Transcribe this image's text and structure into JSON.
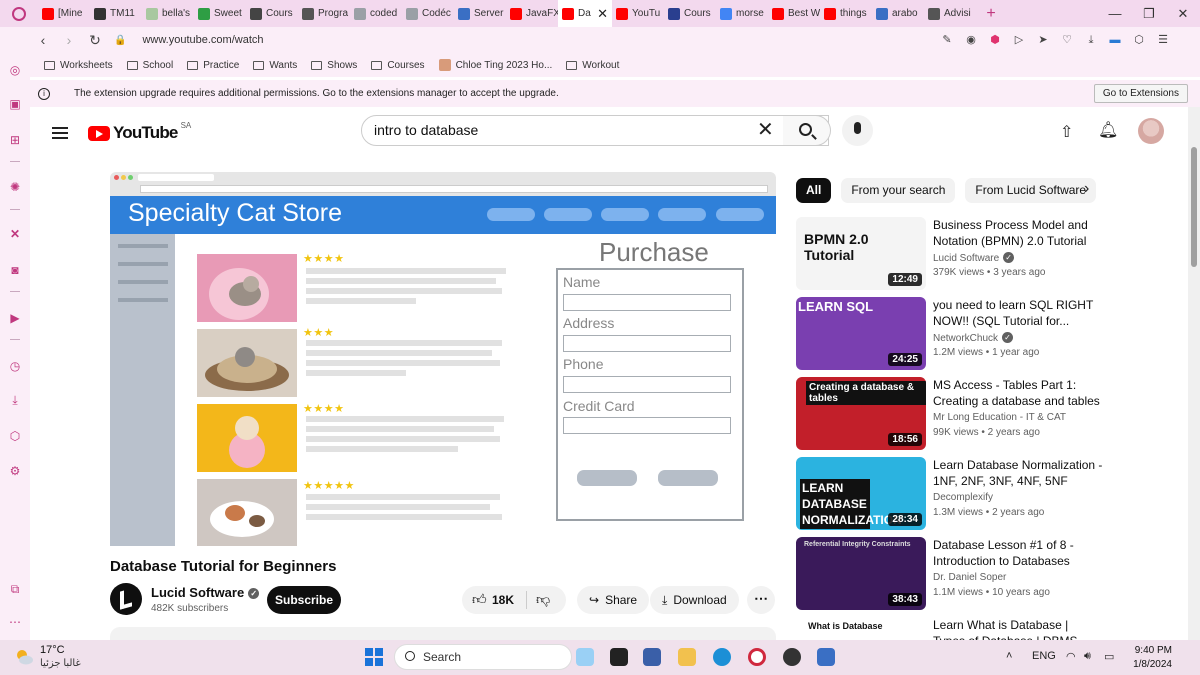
{
  "browser": {
    "tabs": [
      {
        "label": "[Mine",
        "color": "#ff0000"
      },
      {
        "label": "TM11",
        "color": "#333333"
      },
      {
        "label": "bella's",
        "color": "#a8c8a0"
      },
      {
        "label": "Sweet",
        "color": "#2e9e44"
      },
      {
        "label": "Cours",
        "color": "#444444"
      },
      {
        "label": "Progra",
        "color": "#555555"
      },
      {
        "label": "coded",
        "color": "#9aa0a6"
      },
      {
        "label": "Codéc",
        "color": "#9aa0a6"
      },
      {
        "label": "Server",
        "color": "#3a6fc4"
      },
      {
        "label": "JavaFX",
        "color": "#ff0000"
      },
      {
        "label": "Da",
        "color": "#ff0000",
        "active": true
      },
      {
        "label": "YouTu",
        "color": "#ff0000"
      },
      {
        "label": "Cours",
        "color": "#2a3f8f"
      },
      {
        "label": "morse",
        "color": "#4285f4"
      },
      {
        "label": "Best W",
        "color": "#ff0000"
      },
      {
        "label": "things",
        "color": "#ff0000"
      },
      {
        "label": "arabo",
        "color": "#3a6fc4"
      },
      {
        "label": "Advisi",
        "color": "#555555"
      }
    ],
    "url": "www.youtube.com/watch",
    "bookmarks": [
      "Worksheets",
      "School",
      "Practice",
      "Wants",
      "Shows",
      "Courses",
      "Chloe Ting 2023 Ho...",
      "Workout"
    ],
    "info_message": "The extension upgrade requires additional permissions. Go to the extensions manager to accept the upgrade.",
    "info_button": "Go to Extensions"
  },
  "youtube": {
    "logo_text": "YouTube",
    "country_code": "SA",
    "search_value": "intro to database",
    "video": {
      "title": "Database Tutorial for Beginners",
      "channel": "Lucid Software",
      "subscribers": "482K subscribers",
      "subscribe_label": "Subscribe",
      "likes": "18K",
      "share_label": "Share",
      "download_label": "Download"
    },
    "frame": {
      "store_title": "Specialty Cat Store",
      "purchase_title": "Purchase",
      "fields": [
        "Name",
        "Address",
        "Phone",
        "Credit Card"
      ],
      "ratings": [
        4,
        3,
        4,
        5
      ]
    },
    "chips": [
      "All",
      "From your search",
      "From Lucid Software"
    ],
    "recommendations": [
      {
        "title": "Business Process Model and Notation (BPMN) 2.0 Tutorial",
        "channel": "Lucid Software",
        "verified": true,
        "views": "379K views",
        "age": "3 years ago",
        "duration": "12:49",
        "thumb_text": "BPMN 2.0 Tutorial",
        "thumb_bg": "#f4f4f4"
      },
      {
        "title": "you need to learn SQL RIGHT NOW!! (SQL Tutorial for...",
        "channel": "NetworkChuck",
        "verified": true,
        "views": "1.2M views",
        "age": "1 year ago",
        "duration": "24:25",
        "thumb_text": "LEARN SQL",
        "thumb_bg": "#7a3fb0"
      },
      {
        "title": "MS Access - Tables Part 1: Creating a database and tables",
        "channel": "Mr Long Education - IT & CAT",
        "verified": false,
        "views": "99K views",
        "age": "2 years ago",
        "duration": "18:56",
        "thumb_text": "Creating a database & tables",
        "thumb_bg": "#c21f2a"
      },
      {
        "title": "Learn Database Normalization - 1NF, 2NF, 3NF, 4NF, 5NF",
        "channel": "Decomplexify",
        "verified": false,
        "views": "1.3M views",
        "age": "2 years ago",
        "duration": "28:34",
        "thumb_text": "LEARN DATABASE NORMALIZATION",
        "thumb_bg": "#2bb3e0"
      },
      {
        "title": "Database Lesson #1 of 8 - Introduction to Databases",
        "channel": "Dr. Daniel Soper",
        "verified": false,
        "views": "1.1M views",
        "age": "10 years ago",
        "duration": "38:43",
        "thumb_text": "Referential Integrity Constraints",
        "thumb_bg": "#3a1a5a"
      },
      {
        "title": "Learn What is Database | Types of Database | DBMS",
        "channel": "",
        "verified": false,
        "views": "",
        "age": "",
        "duration": "",
        "thumb_text": "What is Database",
        "thumb_bg": "#ffffff"
      }
    ]
  },
  "taskbar": {
    "temperature": "17°C",
    "weather_desc": "غالبا جزئيا",
    "search_label": "Search",
    "language": "ENG",
    "time": "9:40 PM",
    "date": "1/8/2024"
  }
}
